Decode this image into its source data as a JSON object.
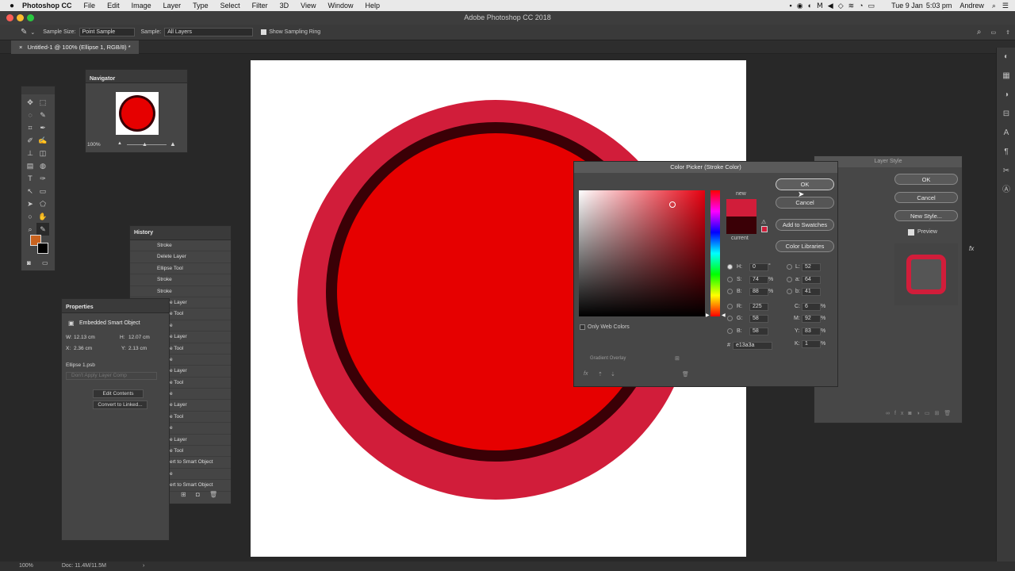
{
  "menu": {
    "app": "Photoshop CC",
    "items": [
      "File",
      "Edit",
      "Image",
      "Layer",
      "Type",
      "Select",
      "Filter",
      "3D",
      "View",
      "Window",
      "Help"
    ],
    "date": "Tue 9 Jan",
    "time": "5:03 pm",
    "user": "Andrew"
  },
  "window": {
    "title": "Adobe Photoshop CC 2018"
  },
  "options": {
    "sample_size_label": "Sample Size:",
    "sample_size_value": "Point Sample",
    "sample_label": "Sample:",
    "sample_value": "All Layers",
    "ring_label": "Show Sampling Ring"
  },
  "document": {
    "tab": "Untitled-1 @ 100% (Ellipse 1, RGB/8) *"
  },
  "navigator": {
    "title": "Navigator",
    "zoom": "100%"
  },
  "history": {
    "title": "History",
    "items": [
      "Stroke",
      "Delete Layer",
      "Ellipse Tool",
      "Stroke",
      "Stroke",
      "e Layer",
      "e Tool",
      "e",
      "e Layer",
      "e Tool",
      "e",
      "e Layer",
      "e Tool",
      "e",
      "e Layer",
      "e Tool",
      "e",
      "e Layer",
      "e Tool",
      "ert to Smart Object",
      "e",
      "ert to Smart Object"
    ]
  },
  "properties": {
    "title": "Properties",
    "kind": "Embedded Smart Object",
    "w_label": "W:",
    "w": "12.13 cm",
    "h_label": "H:",
    "h": "12.07 cm",
    "x_label": "X:",
    "x": "2.36 cm",
    "y_label": "Y:",
    "y": "2.13 cm",
    "file": "Ellipse 1.psb",
    "comp": "Don't Apply Layer Comp",
    "edit_btn": "Edit Contents",
    "convert_btn": "Convert to Linked..."
  },
  "layer_style": {
    "title": "Layer Style",
    "ok": "OK",
    "cancel": "Cancel",
    "new_style": "New Style...",
    "preview": "Preview",
    "gradient_overlay": "Gradient Overlay"
  },
  "color_picker": {
    "title": "Color Picker (Stroke Color)",
    "ok": "OK",
    "cancel": "Cancel",
    "add_swatches": "Add to Swatches",
    "color_libraries": "Color Libraries",
    "new_label": "new",
    "current_label": "current",
    "only_web": "Only Web Colors",
    "H": "0",
    "S": "74",
    "B": "88",
    "R": "225",
    "G": "58",
    "Bv": "58",
    "L": "52",
    "a": "64",
    "b": "41",
    "C": "6",
    "M": "92",
    "Y": "83",
    "K": "1",
    "hex": "e13a3a",
    "new_color": "#d11d3a",
    "current_color": "#3a0006"
  },
  "status": {
    "zoom": "100%",
    "doc": "Doc: 11.4M/11.5M"
  }
}
